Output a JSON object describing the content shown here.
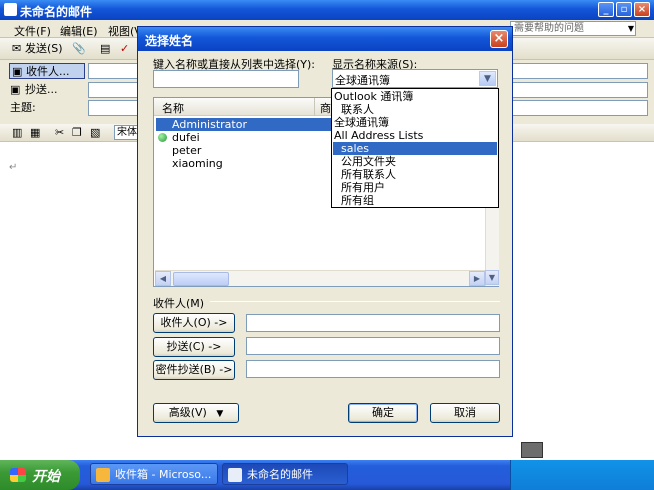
{
  "window": {
    "title": "未命名的邮件",
    "help_placeholder": "需要帮助的问题",
    "menu": [
      "文件(F)",
      "编辑(E)",
      "视图(V)"
    ]
  },
  "toolbar": {
    "send_label": "发送(S)"
  },
  "address": {
    "to_label": "收件人...",
    "cc_label": "抄送...",
    "subject_label": "主题:"
  },
  "format_toolbar": {
    "font_name": "宋体"
  },
  "dialog": {
    "title": "选择姓名",
    "search_label": "键入名称或直接从列表中选择(Y):",
    "source_label": "显示名称来源(S):",
    "source_value": "全球通讯簿",
    "columns": [
      "名称",
      "商务"
    ],
    "names": [
      {
        "name": "Administrator",
        "selected": true,
        "presence": false
      },
      {
        "name": "dufei",
        "selected": false,
        "presence": true
      },
      {
        "name": "peter",
        "selected": false,
        "presence": false
      },
      {
        "name": "xiaoming",
        "selected": false,
        "presence": false
      }
    ],
    "recipients_label": "收件人(M)",
    "to_button": "收件人(O) ->",
    "cc_button": "抄送(C) ->",
    "bcc_button": "密件抄送(B) ->",
    "advanced_button": "高级(V)",
    "ok_button": "确定",
    "cancel_button": "取消",
    "source_options": [
      {
        "label": "Outlook 通讯簿",
        "indent": 0,
        "selected": false
      },
      {
        "label": "联系人",
        "indent": 1,
        "selected": false
      },
      {
        "label": "全球通讯簿",
        "indent": 0,
        "selected": false
      },
      {
        "label": "All Address Lists",
        "indent": 0,
        "selected": false
      },
      {
        "label": "sales",
        "indent": 1,
        "selected": true
      },
      {
        "label": "公用文件夹",
        "indent": 1,
        "selected": false
      },
      {
        "label": "所有联系人",
        "indent": 1,
        "selected": false
      },
      {
        "label": "所有用户",
        "indent": 1,
        "selected": false
      },
      {
        "label": "所有组",
        "indent": 1,
        "selected": false
      }
    ]
  },
  "taskbar": {
    "start_label": "开始",
    "tasks": [
      "收件箱 - Microso...",
      "未命名的邮件"
    ]
  }
}
